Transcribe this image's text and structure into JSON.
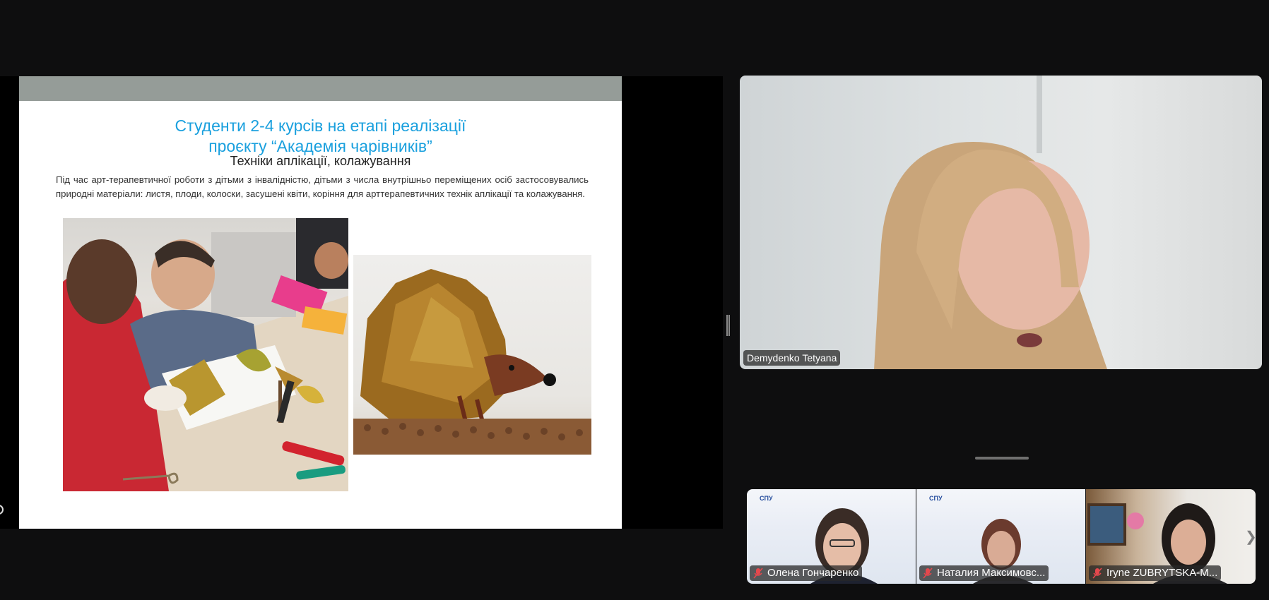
{
  "slide": {
    "title_line1": "Студенти 2-4 курсів на етапі реалізації",
    "title_line2": "проєкту “Академія чарівників”",
    "subtitle": "Техніки аплікації, колажування",
    "body": "Під час арт-терапевтичної роботи з дітьми з інвалідністю, дітьми з числа внутрішньо переміщених осіб застосовувались природні матеріали: листя, плоди, колоски, засушені квіти, коріння для арттерапевтичних технік аплікації та колажування.",
    "accent_color": "#1aa0de"
  },
  "speaker": {
    "name": "Demydenko Tetyana"
  },
  "participants": [
    {
      "name": "Олена Гончаренко",
      "mic": "muted",
      "logo": "СПУ"
    },
    {
      "name": "Наталия Максимовс...",
      "mic": "muted",
      "logo": "СПУ"
    },
    {
      "name": "Iryne ZUBRYTSKA-M...",
      "mic": "muted"
    }
  ],
  "icons": {
    "mic_off": "mic-off-icon",
    "next": "chevron-right-icon"
  }
}
